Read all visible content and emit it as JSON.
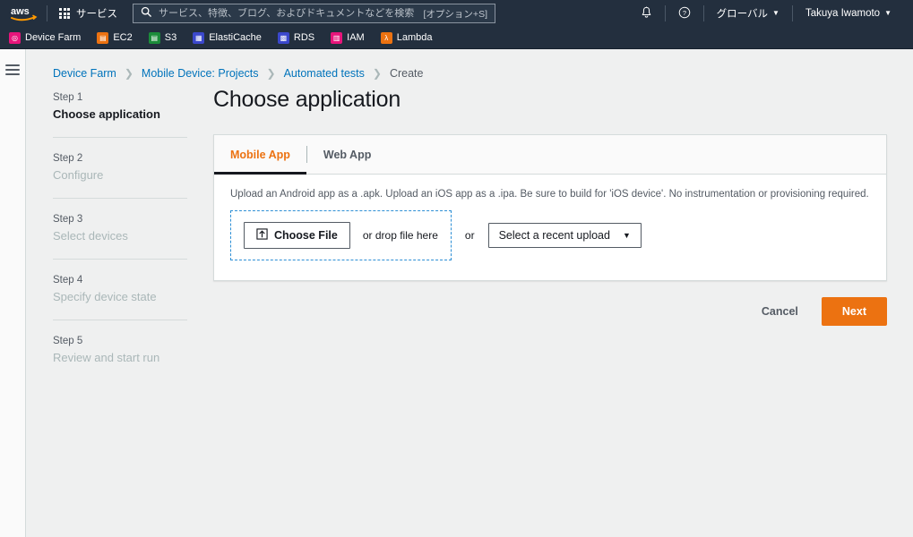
{
  "topnav": {
    "logo_alt": "aws",
    "services_label": "サービス",
    "search": {
      "placeholder": "サービス、特徴、ブログ、およびドキュメントなどを検索",
      "value": "",
      "shortcut": "[オプション+S]"
    },
    "notifications_icon": "bell-icon",
    "help_icon": "question-circle-icon",
    "region_label": "グローバル",
    "account_label": "Takuya Iwamoto",
    "caret": "▼"
  },
  "favorites": [
    {
      "label": "Device Farm",
      "icon": "device-farm-icon",
      "color": "#e7157b",
      "glyph": "◎"
    },
    {
      "label": "EC2",
      "icon": "ec2-icon",
      "color": "#ec7211",
      "glyph": "▤"
    },
    {
      "label": "S3",
      "icon": "s3-icon",
      "color": "#1b8c3a",
      "glyph": "▤"
    },
    {
      "label": "ElastiCache",
      "icon": "elasticache-icon",
      "color": "#3b48cc",
      "glyph": "▦"
    },
    {
      "label": "RDS",
      "icon": "rds-icon",
      "color": "#3b48cc",
      "glyph": "▩"
    },
    {
      "label": "IAM",
      "icon": "iam-icon",
      "color": "#e7157b",
      "glyph": "▥"
    },
    {
      "label": "Lambda",
      "icon": "lambda-icon",
      "color": "#ec7211",
      "glyph": "λ"
    }
  ],
  "breadcrumb": {
    "items": [
      {
        "label": "Device Farm",
        "current": false
      },
      {
        "label": "Mobile Device: Projects",
        "current": false
      },
      {
        "label": "Automated tests",
        "current": false
      },
      {
        "label": "Create",
        "current": true
      }
    ],
    "separator": "❯"
  },
  "steps": [
    {
      "num": "Step 1",
      "name": "Choose application",
      "state": "active"
    },
    {
      "num": "Step 2",
      "name": "Configure",
      "state": "inactive"
    },
    {
      "num": "Step 3",
      "name": "Select devices",
      "state": "inactive"
    },
    {
      "num": "Step 4",
      "name": "Specify device state",
      "state": "inactive"
    },
    {
      "num": "Step 5",
      "name": "Review and start run",
      "state": "inactive"
    }
  ],
  "main": {
    "page_title": "Choose application",
    "tabs": [
      {
        "label": "Mobile App",
        "active": true
      },
      {
        "label": "Web App",
        "active": false
      }
    ],
    "description": "Upload an Android app as a .apk. Upload an iOS app as a .ipa. Be sure to build for 'iOS device'. No instrumentation or provisioning required.",
    "upload": {
      "choose_file_label": "Choose File",
      "choose_file_icon": "upload-icon",
      "drop_text": "or drop file here",
      "or_label": "or",
      "recent_upload_label": "Select a recent upload",
      "recent_upload_caret": "▼"
    }
  },
  "actions": {
    "cancel_label": "Cancel",
    "next_label": "Next"
  },
  "colors": {
    "nav_bg": "#232f3e",
    "accent_orange": "#ec7211",
    "link_blue": "#0073bb",
    "dropzone_blue": "#2d8fd5",
    "page_bg": "#eff0f0"
  }
}
